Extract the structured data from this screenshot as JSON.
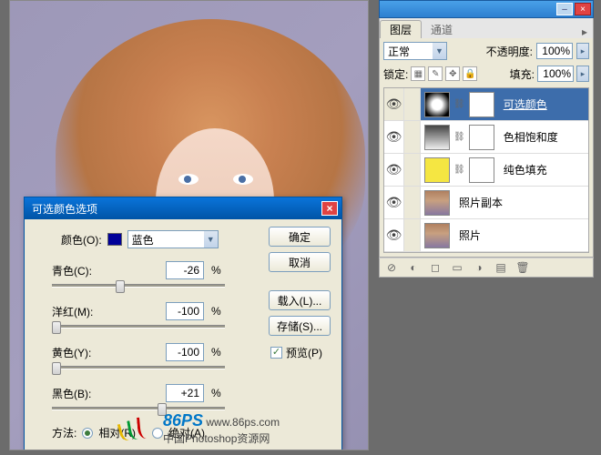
{
  "dialog": {
    "title": "可选颜色选项",
    "color_label": "颜色(O):",
    "color_value": "蓝色",
    "sliders": [
      {
        "label": "青色(C):",
        "value": "-26",
        "thumb_pct": 37
      },
      {
        "label": "洋红(M):",
        "value": "-100",
        "thumb_pct": 0
      },
      {
        "label": "黄色(Y):",
        "value": "-100",
        "thumb_pct": 0
      },
      {
        "label": "黑色(B):",
        "value": "+21",
        "thumb_pct": 61
      }
    ],
    "percent": "%",
    "method_label": "方法:",
    "method_relative": "相对(R)",
    "method_absolute": "绝对(A)",
    "buttons": {
      "ok": "确定",
      "cancel": "取消",
      "load": "载入(L)...",
      "save": "存储(S)..."
    },
    "preview": "预览(P)"
  },
  "watermark": {
    "brand_num": "86",
    "brand_ps": "PS",
    "url": "www.86ps.com",
    "tagline": "中国Photoshop资源网"
  },
  "layers": {
    "tabs": {
      "layers": "图层",
      "channels": "通道"
    },
    "blend_mode": "正常",
    "opacity_label": "不透明度:",
    "opacity_value": "100%",
    "lock_label": "锁定:",
    "fill_label": "填充:",
    "fill_value": "100%",
    "items": [
      {
        "name": "可选颜色",
        "selected": true,
        "type": "sc"
      },
      {
        "name": "色相饱和度",
        "selected": false,
        "type": "hue"
      },
      {
        "name": "纯色填充",
        "selected": false,
        "type": "fill"
      },
      {
        "name": "照片副本",
        "selected": false,
        "type": "photo"
      },
      {
        "name": "照片",
        "selected": false,
        "type": "photo"
      }
    ]
  }
}
